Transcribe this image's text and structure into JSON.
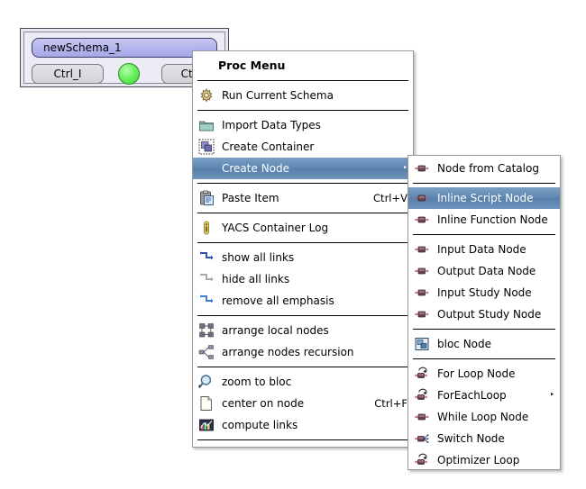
{
  "canvas": {
    "node": {
      "title": "newSchema_1",
      "input_port": "Ctrl_I",
      "output_port": "Ctrl_O",
      "status_color": "#55e24a",
      "title_color": "#b0b0ec"
    }
  },
  "proc_menu": {
    "title": "Proc Menu",
    "highlight_color": "#5d87b3",
    "items": [
      {
        "id": "run-current-schema",
        "label": "Run Current Schema",
        "icon": "gear-icon",
        "accel": "",
        "arrow": false,
        "selected": false,
        "sep_after": true
      },
      {
        "id": "import-data-types",
        "label": "Import Data Types",
        "icon": "folder-icon",
        "accel": "",
        "arrow": false,
        "selected": false,
        "sep_after": false
      },
      {
        "id": "create-container",
        "label": "Create Container",
        "icon": "container-icon",
        "accel": "",
        "arrow": false,
        "selected": false,
        "sep_after": false
      },
      {
        "id": "create-node",
        "label": "Create Node",
        "icon": "none-icon",
        "accel": "",
        "arrow": true,
        "selected": true,
        "sep_after": true
      },
      {
        "id": "paste-item",
        "label": "Paste Item",
        "icon": "clipboard-icon",
        "accel": "Ctrl+V",
        "arrow": false,
        "selected": false,
        "sep_after": true
      },
      {
        "id": "yacs-container-log",
        "label": "YACS Container Log",
        "icon": "info-icon",
        "accel": "",
        "arrow": false,
        "selected": false,
        "sep_after": true
      },
      {
        "id": "show-all-links",
        "label": "show all links",
        "icon": "link-show-icon",
        "accel": "",
        "arrow": false,
        "selected": false,
        "sep_after": false
      },
      {
        "id": "hide-all-links",
        "label": "hide all links",
        "icon": "link-hide-icon",
        "accel": "",
        "arrow": false,
        "selected": false,
        "sep_after": false
      },
      {
        "id": "remove-all-emphasis",
        "label": "remove all emphasis",
        "icon": "link-emphasis-icon",
        "accel": "",
        "arrow": false,
        "selected": false,
        "sep_after": true
      },
      {
        "id": "arrange-local-nodes",
        "label": "arrange local nodes",
        "icon": "arrange-grid-icon",
        "accel": "",
        "arrow": false,
        "selected": false,
        "sep_after": false
      },
      {
        "id": "arrange-nodes-recursion",
        "label": "arrange nodes recursion",
        "icon": "arrange-tree-icon",
        "accel": "",
        "arrow": false,
        "selected": false,
        "sep_after": true
      },
      {
        "id": "zoom-to-bloc",
        "label": "zoom to bloc",
        "icon": "magnifier-icon",
        "accel": "",
        "arrow": false,
        "selected": false,
        "sep_after": false
      },
      {
        "id": "center-on-node",
        "label": "center on node",
        "icon": "page-icon",
        "accel": "Ctrl+F",
        "arrow": false,
        "selected": false,
        "sep_after": false
      },
      {
        "id": "compute-links",
        "label": "compute links",
        "icon": "chart-icon",
        "accel": "",
        "arrow": false,
        "selected": false,
        "sep_after": true
      }
    ]
  },
  "create_node_menu": {
    "items": [
      {
        "id": "node-from-catalog",
        "label": "Node from Catalog",
        "icon": "node-icon",
        "arrow": false,
        "selected": false,
        "sep_after": true
      },
      {
        "id": "inline-script-node",
        "label": "Inline Script Node",
        "icon": "node-icon",
        "arrow": false,
        "selected": true,
        "sep_after": false
      },
      {
        "id": "inline-function-node",
        "label": "Inline Function Node",
        "icon": "node-icon",
        "arrow": false,
        "selected": false,
        "sep_after": true
      },
      {
        "id": "input-data-node",
        "label": "Input Data Node",
        "icon": "node-icon",
        "arrow": false,
        "selected": false,
        "sep_after": false
      },
      {
        "id": "output-data-node",
        "label": "Output Data Node",
        "icon": "node-icon",
        "arrow": false,
        "selected": false,
        "sep_after": false
      },
      {
        "id": "input-study-node",
        "label": "Input Study Node",
        "icon": "node-icon",
        "arrow": false,
        "selected": false,
        "sep_after": false
      },
      {
        "id": "output-study-node",
        "label": "Output Study Node",
        "icon": "node-icon",
        "arrow": false,
        "selected": false,
        "sep_after": true
      },
      {
        "id": "bloc-node",
        "label": "bloc Node",
        "icon": "bloc-icon",
        "arrow": false,
        "selected": false,
        "sep_after": true
      },
      {
        "id": "for-loop-node",
        "label": "For Loop Node",
        "icon": "loop-icon",
        "arrow": false,
        "selected": false,
        "sep_after": false
      },
      {
        "id": "foreach-loop",
        "label": "ForEachLoop",
        "icon": "loop-icon",
        "arrow": true,
        "selected": false,
        "sep_after": false
      },
      {
        "id": "while-loop-node",
        "label": "While Loop Node",
        "icon": "node-icon",
        "arrow": false,
        "selected": false,
        "sep_after": false
      },
      {
        "id": "switch-node",
        "label": "Switch Node",
        "icon": "switch-icon",
        "arrow": false,
        "selected": false,
        "sep_after": false
      },
      {
        "id": "optimizer-loop",
        "label": "Optimizer Loop",
        "icon": "loop-icon",
        "arrow": false,
        "selected": false,
        "sep_after": false
      }
    ]
  },
  "glyphs": {
    "submenu_arrow": "‣"
  }
}
